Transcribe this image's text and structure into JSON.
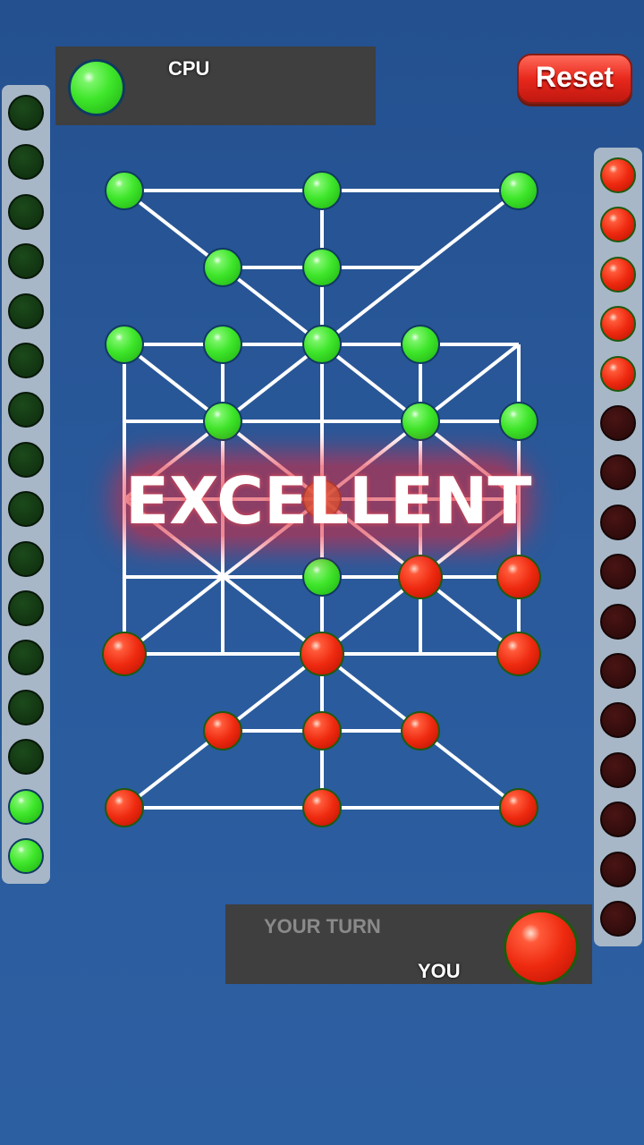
{
  "cpu_panel": {
    "label": "CPU",
    "piece_color": "green"
  },
  "reset_button": {
    "label": "Reset"
  },
  "turn_panel": {
    "status": "YOUR TURN",
    "label": "YOU",
    "piece_color": "red"
  },
  "banner": {
    "text": "EXCELLENT"
  },
  "colors": {
    "green": "#3ee62a",
    "red": "#ee2a10",
    "background": "#2a5a9c",
    "panel": "#3f3f3f"
  },
  "left_captures": {
    "total_slots": 16,
    "filled": 2,
    "color": "green"
  },
  "right_captures": {
    "total_slots": 16,
    "filled": 5,
    "color": "red"
  },
  "board": {
    "pieces": [
      {
        "col": 0,
        "row": 0,
        "color": "green"
      },
      {
        "col": 2,
        "row": 0,
        "color": "green"
      },
      {
        "col": 4,
        "row": 0,
        "color": "green"
      },
      {
        "col": 1,
        "row": 1,
        "color": "green"
      },
      {
        "col": 2,
        "row": 1,
        "color": "green"
      },
      {
        "col": 0,
        "row": 2,
        "color": "green"
      },
      {
        "col": 1,
        "row": 2,
        "color": "green"
      },
      {
        "col": 2,
        "row": 2,
        "color": "green"
      },
      {
        "col": 3,
        "row": 2,
        "color": "green"
      },
      {
        "col": 1,
        "row": 3,
        "color": "green"
      },
      {
        "col": 3,
        "row": 3,
        "color": "green"
      },
      {
        "col": 4,
        "row": 3,
        "color": "green"
      },
      {
        "col": 2,
        "row": 4,
        "color": "orange"
      },
      {
        "col": 2,
        "row": 5,
        "color": "green"
      },
      {
        "col": 3,
        "row": 5,
        "color": "red"
      },
      {
        "col": 4,
        "row": 5,
        "color": "red"
      },
      {
        "col": 0,
        "row": 6,
        "color": "red"
      },
      {
        "col": 2,
        "row": 6,
        "color": "red"
      },
      {
        "col": 4,
        "row": 6,
        "color": "red"
      },
      {
        "col": 1,
        "row": 7,
        "color": "red"
      },
      {
        "col": 2,
        "row": 7,
        "color": "red"
      },
      {
        "col": 3,
        "row": 7,
        "color": "red"
      },
      {
        "col": 0,
        "row": 8,
        "color": "red"
      },
      {
        "col": 2,
        "row": 8,
        "color": "red"
      },
      {
        "col": 4,
        "row": 8,
        "color": "red"
      }
    ]
  }
}
